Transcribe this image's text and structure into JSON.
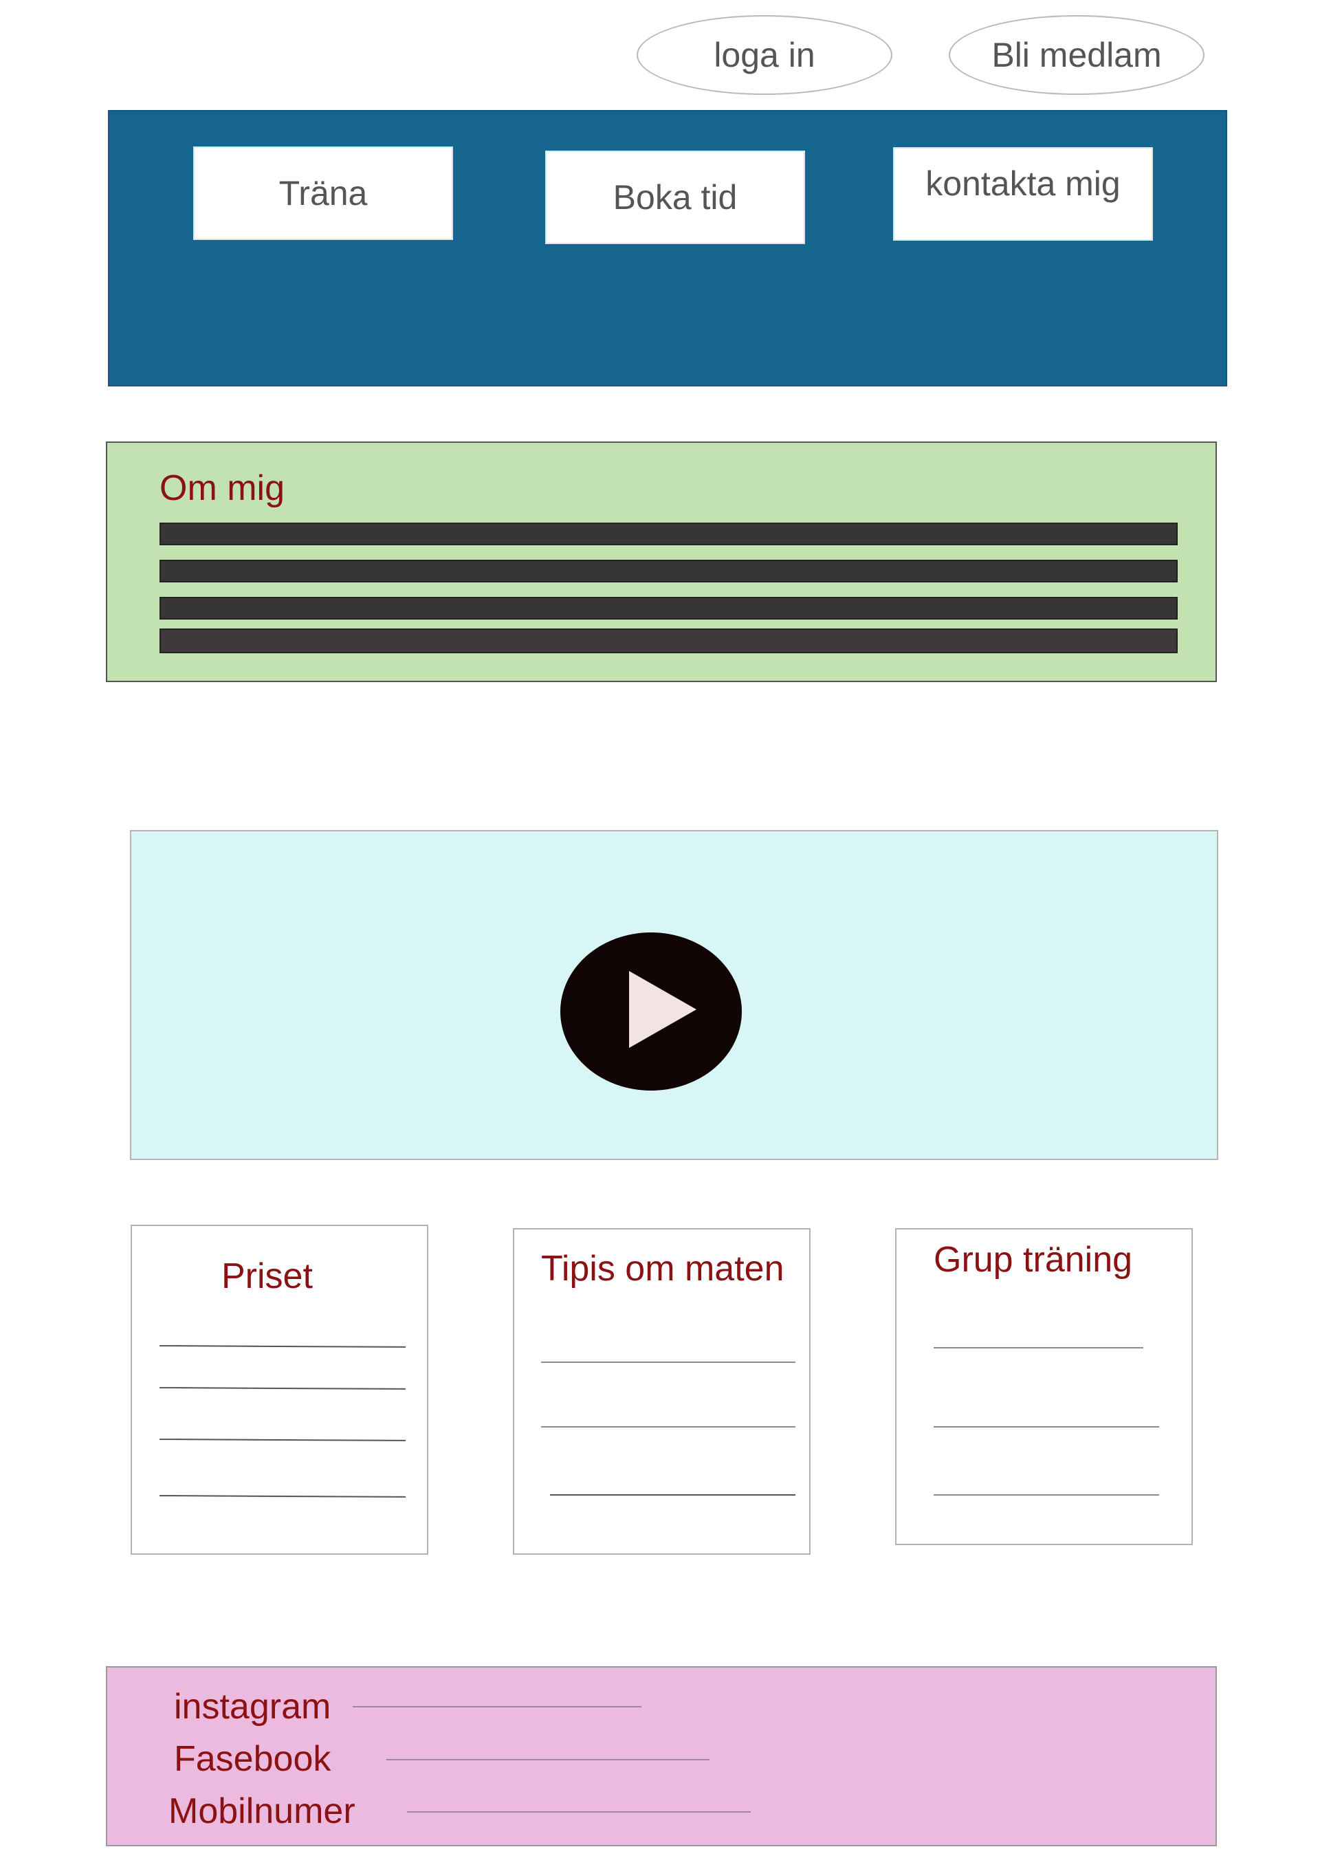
{
  "auth": {
    "login_label": "loga in",
    "signup_label": "Bli medlam"
  },
  "nav": {
    "items": [
      {
        "label": "Träna"
      },
      {
        "label": "Boka tid"
      },
      {
        "label": "kontakta mig"
      }
    ]
  },
  "about": {
    "title": "Om mig"
  },
  "video": {
    "icon": "play-icon"
  },
  "cards": [
    {
      "title": "Priset"
    },
    {
      "title": "Tipis om maten"
    },
    {
      "title": "Grup träning"
    }
  ],
  "footer": {
    "links": [
      {
        "label": "instagram"
      },
      {
        "label": "Fasebook"
      },
      {
        "label": "Mobilnumer"
      }
    ]
  },
  "colors": {
    "header_bg": "#15658e",
    "about_bg": "#c3e2b2",
    "video_bg": "#d9f6f6",
    "footer_bg": "#ecb9df",
    "accent_text": "#8b1212"
  }
}
